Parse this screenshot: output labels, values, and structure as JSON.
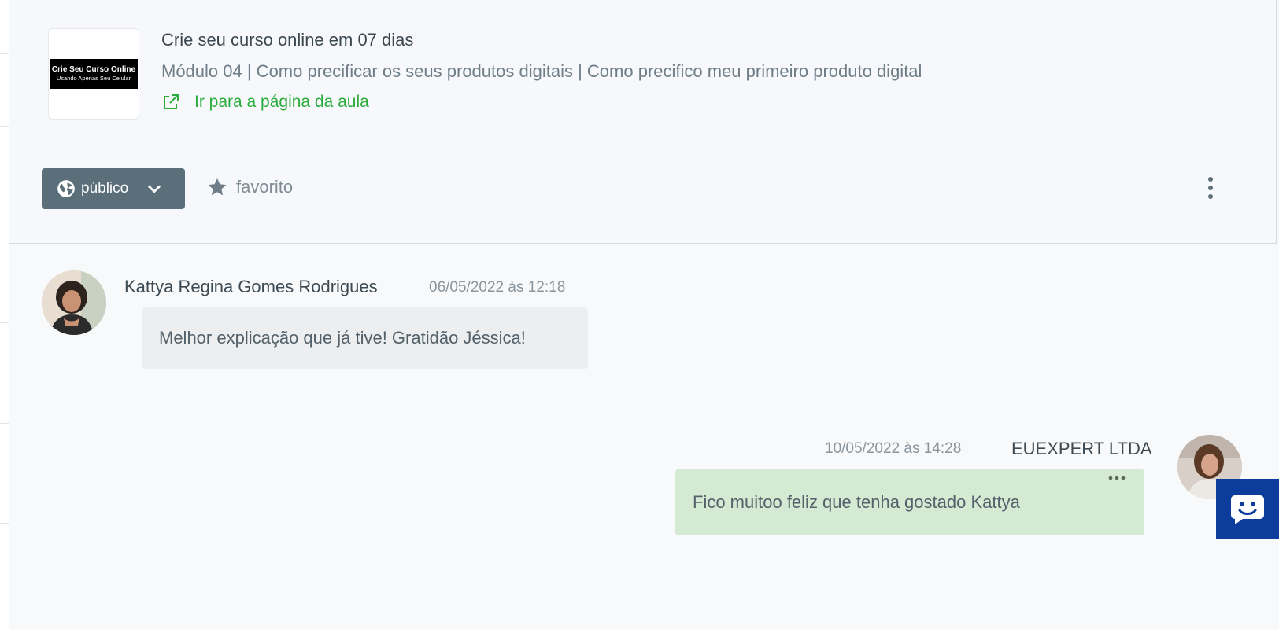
{
  "course": {
    "title": "Crie seu curso online em 07 dias",
    "thumbnail_line1": "Crie Seu Curso Online",
    "thumbnail_line2": "Usando Apenas Seu Celular",
    "lesson_path": "Módulo 04 | Como precificar os seus produtos digitais | Como precifico meu primeiro produto digital",
    "lesson_link_label": "Ir para a página da aula"
  },
  "actions": {
    "visibility_label": "público",
    "favorite_label": "favorito"
  },
  "comments": [
    {
      "author": "Kattya Regina Gomes Rodrigues",
      "timestamp": "06/05/2022 às 12:18",
      "text": "Melhor explicação que já tive! Gratidão Jéssica!"
    },
    {
      "author": "EUEXPERT LTDA",
      "timestamp": "10/05/2022 às 14:28",
      "text": "Fico muitoo feliz que tenha gostado Kattya"
    }
  ],
  "colors": {
    "accent_green": "#2bac3d",
    "visibility_button": "#5b6f7a",
    "reply_bubble": "#d4ead3",
    "chat_widget": "#0c3d9c"
  },
  "icons": [
    "external-link-icon",
    "globe-icon",
    "chevron-down-icon",
    "star-icon",
    "vertical-dots-icon",
    "horizontal-dots-icon",
    "chat-bot-icon"
  ]
}
